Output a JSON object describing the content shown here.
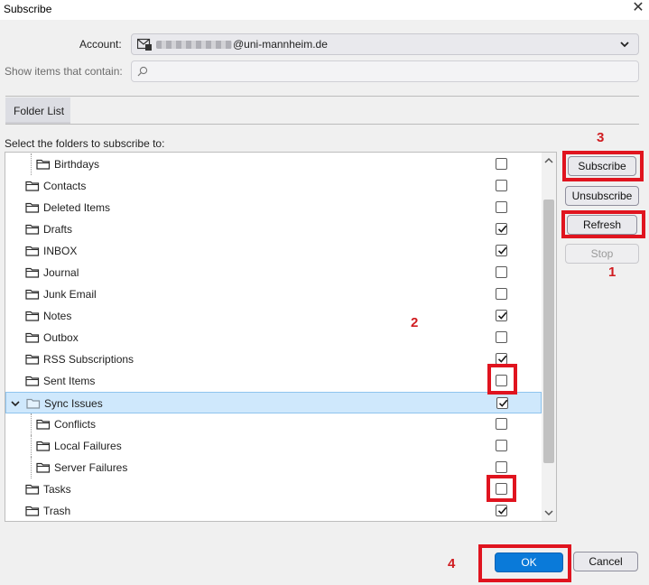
{
  "window": {
    "title": "Subscribe",
    "close_glyph": "✕"
  },
  "account": {
    "label": "Account:",
    "email_suffix": "@uni-mannheim.de",
    "icon": "mail-account-icon"
  },
  "filter": {
    "label": "Show items that contain:",
    "value": "",
    "placeholder": "",
    "icon": "search-icon"
  },
  "tabs": [
    {
      "label": "Folder List"
    }
  ],
  "instructions": "Select the folders to subscribe to:",
  "folders": [
    {
      "name": "Birthdays",
      "depth": 1,
      "checked": false
    },
    {
      "name": "Contacts",
      "depth": 0,
      "checked": false
    },
    {
      "name": "Deleted Items",
      "depth": 0,
      "checked": false
    },
    {
      "name": "Drafts",
      "depth": 0,
      "checked": true
    },
    {
      "name": "INBOX",
      "depth": 0,
      "checked": true
    },
    {
      "name": "Journal",
      "depth": 0,
      "checked": false
    },
    {
      "name": "Junk Email",
      "depth": 0,
      "checked": false
    },
    {
      "name": "Notes",
      "depth": 0,
      "checked": true
    },
    {
      "name": "Outbox",
      "depth": 0,
      "checked": false
    },
    {
      "name": "RSS Subscriptions",
      "depth": 0,
      "checked": true
    },
    {
      "name": "Sent Items",
      "depth": 0,
      "checked": false
    },
    {
      "name": "Sync Issues",
      "depth": 0,
      "checked": true,
      "expanded": true,
      "selected": true
    },
    {
      "name": "Conflicts",
      "depth": 1,
      "checked": false
    },
    {
      "name": "Local Failures",
      "depth": 1,
      "checked": false
    },
    {
      "name": "Server Failures",
      "depth": 1,
      "checked": false
    },
    {
      "name": "Tasks",
      "depth": 0,
      "checked": false
    },
    {
      "name": "Trash",
      "depth": 0,
      "checked": true
    }
  ],
  "buttons": {
    "subscribe": "Subscribe",
    "unsubscribe": "Unsubscribe",
    "refresh": "Refresh",
    "stop": "Stop",
    "ok": "OK",
    "cancel": "Cancel"
  },
  "annotations": {
    "a1": "1",
    "a2": "2",
    "a3": "3",
    "a4": "4"
  },
  "colors": {
    "highlight": "#e0141f",
    "selection": "#cfe8fc",
    "primary": "#0a7ad9"
  }
}
